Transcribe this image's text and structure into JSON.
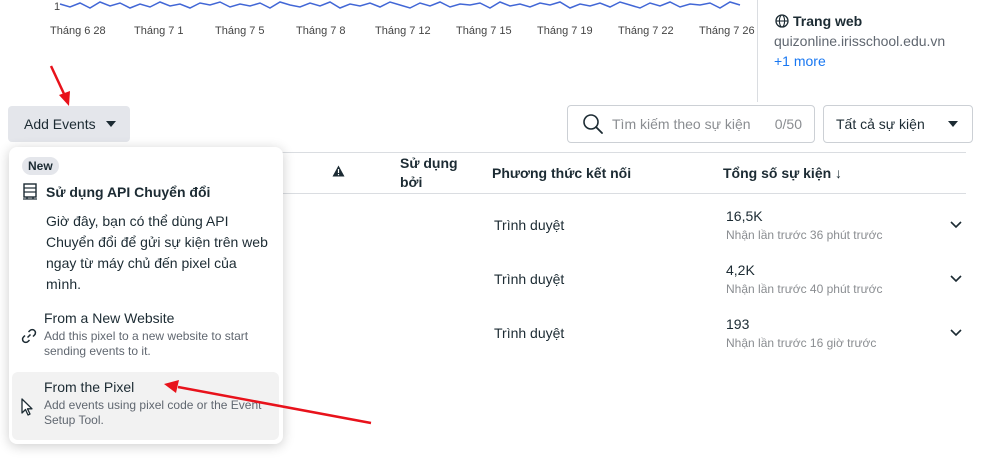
{
  "chart": {
    "y_tick": "1",
    "x_ticks": [
      "Tháng 6 28",
      "Tháng 7 1",
      "Tháng 7 5",
      "Tháng 7 8",
      "Tháng 7 12",
      "Tháng 7 15",
      "Tháng 7 19",
      "Tháng 7 22",
      "Tháng 7 26"
    ],
    "line_color": "#4267d6"
  },
  "side": {
    "website_label": "Trang web",
    "website_url": "quizonline.irisschool.edu.vn",
    "more_link": "+1 more"
  },
  "toolbar": {
    "add_events_label": "Add Events",
    "search_placeholder": "Tìm kiếm theo sự kiện",
    "search_count": "0/50",
    "filter_value": "Tất cả sự kiện"
  },
  "table": {
    "headers": {
      "used_by": "Sử dụng bởi",
      "connection_method": "Phương thức kết nối",
      "total_events": "Tổng số sự kiện ↓"
    },
    "rows": [
      {
        "method": "Trình duyệt",
        "total": "16,5K",
        "last_received": "Nhận lần trước 36 phút trước"
      },
      {
        "method": "Trình duyệt",
        "total": "4,2K",
        "last_received": "Nhận lần trước 40 phút trước"
      },
      {
        "method": "Trình duyệt",
        "total": "193",
        "last_received": "Nhận lần trước 16 giờ trước"
      }
    ]
  },
  "dropdown": {
    "badge": "New",
    "api_title": "Sử dụng API Chuyển đổi",
    "api_description": "Giờ đây, bạn có thể dùng API Chuyển đổi để gửi sự kiện trên web ngay từ máy chủ đến pixel của mình.",
    "items": [
      {
        "title": "From a New Website",
        "description": "Add this pixel to a new website to start sending events to it.",
        "icon": "link-icon"
      },
      {
        "title": "From the Pixel",
        "description": "Add events using pixel code or the Event Setup Tool.",
        "icon": "cursor-icon"
      }
    ]
  },
  "colors": {
    "accent": "#1877f2",
    "annotation_arrow": "#e8121b"
  }
}
